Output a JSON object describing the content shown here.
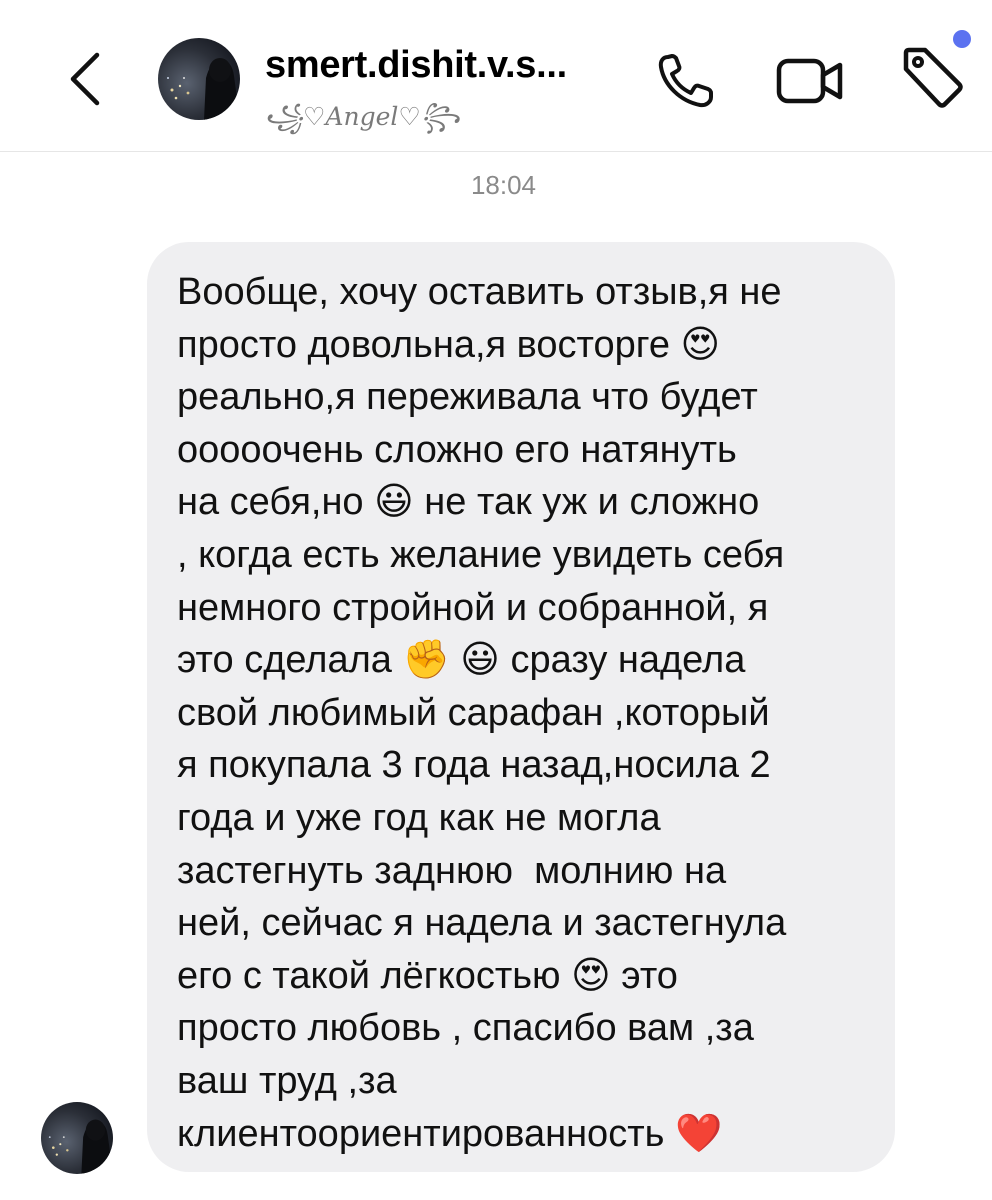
{
  "header": {
    "title": "smert.dishit.v.s...",
    "subtitle": "꧁♡Angel♡꧂"
  },
  "chat": {
    "timestamp": "18:04",
    "message": {
      "lines": [
        "Вообще, хочу оставить отзыв,я не",
        "просто довольна,я восторге 😍",
        "реально,я переживала что будет",
        "ооооочень сложно его натянуть",
        "на себя,но 😃 не так уж и сложно",
        ", когда есть желание увидеть себя",
        "немного стройной и собранной, я",
        "это сделала ✊ 😃 сразу надела",
        "свой любимый сарафан ,который",
        "я покупала 3 года назад,носила 2",
        "года и уже год как не могла",
        "застегнуть заднюю  молнию на",
        "ней, сейчас я надела и застегнула",
        "его с такой лёгкостью 😍 это",
        "просто любовь , спасибо вам ,за",
        "ваш труд ,за",
        "клиентоориентированность ❤️"
      ]
    }
  },
  "icons": {
    "back": "chevron-left-icon",
    "phone": "phone-icon",
    "video": "video-camera-icon",
    "tag": "tag-icon"
  },
  "colors": {
    "bubble": "#efeff1",
    "notification_dot": "#5b72f0",
    "muted_text": "#8a8a8a"
  }
}
